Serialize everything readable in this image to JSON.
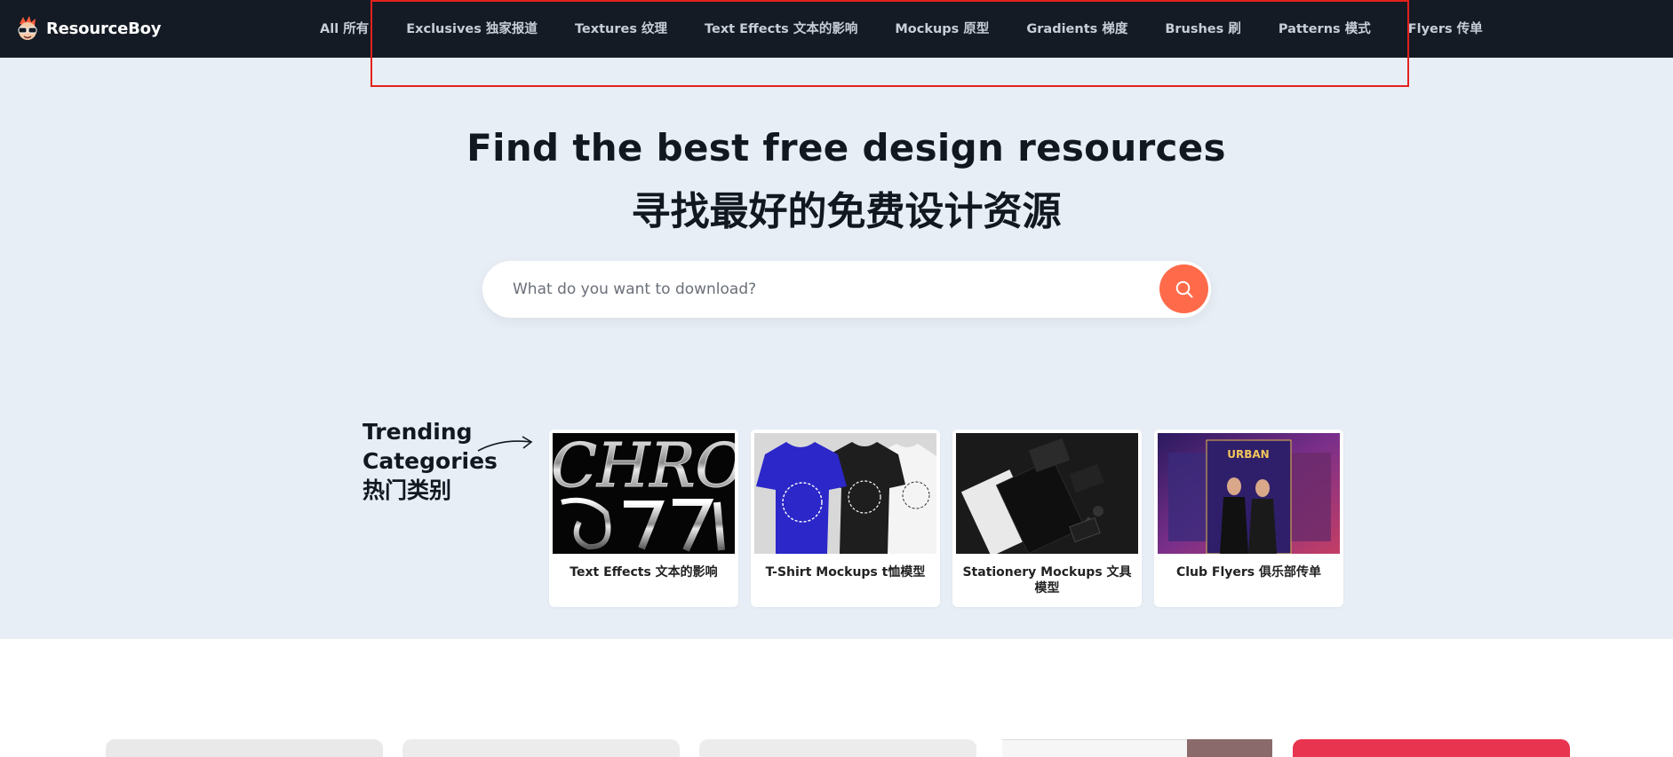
{
  "brand": {
    "name": "ResourceBoy"
  },
  "nav": {
    "items": [
      {
        "label": "All 所有"
      },
      {
        "label": "Exclusives 独家报道"
      },
      {
        "label": "Textures 纹理"
      },
      {
        "label": "Text Effects 文本的影响"
      },
      {
        "label": "Mockups 原型"
      },
      {
        "label": "Gradients 梯度"
      },
      {
        "label": "Brushes 刷"
      },
      {
        "label": "Patterns 模式"
      },
      {
        "label": "Flyers 传单"
      }
    ]
  },
  "hero": {
    "title": "Find the best free design resources",
    "subtitle": "寻找最好的免费设计资源"
  },
  "search": {
    "placeholder": "What do you want to download?",
    "button_icon": "search-icon"
  },
  "trending": {
    "label_line1": "Trending",
    "label_line2": "Categories",
    "label_line3": "热门类别",
    "cards": [
      {
        "label": "Text Effects 文本的影响",
        "image_text": "CHRO"
      },
      {
        "label": "T-Shirt Mockups t恤模型"
      },
      {
        "label": "Stationery Mockups 文具模型"
      },
      {
        "label": "Club Flyers 俱乐部传单",
        "image_text": "URBAN"
      }
    ]
  },
  "colors": {
    "navbar_bg": "#141b24",
    "hero_bg": "#e8eef5",
    "accent": "#ff6b4a",
    "highlight": "#e3211d"
  }
}
